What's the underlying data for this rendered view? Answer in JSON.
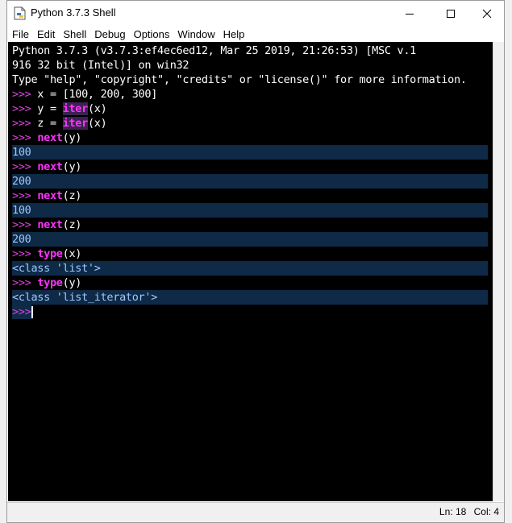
{
  "window": {
    "title": "Python 3.7.3 Shell",
    "controls": {
      "minimize": "—",
      "maximize": "☐",
      "close": "✕"
    }
  },
  "menu": [
    "File",
    "Edit",
    "Shell",
    "Debug",
    "Options",
    "Window",
    "Help"
  ],
  "console": {
    "banner1": "Python 3.7.3 (v3.7.3:ef4ec6ed12, Mar 25 2019, 21:26:53) [MSC v.1",
    "banner2": "916 32 bit (Intel)] on win32",
    "banner3": "Type \"help\", \"copyright\", \"credits\" or \"license()\" for more information.",
    "prompt": ">>>",
    "cmd1": " x = [100, 200, 300]",
    "cmd2_a": " y = ",
    "cmd2_fn": "iter",
    "cmd2_b": "(x)",
    "cmd3_a": " z = ",
    "cmd3_fn": "iter",
    "cmd3_b": "(x)",
    "cmd4_fn": "next",
    "cmd4_b": "(y)",
    "out4": "100",
    "cmd5_fn": "next",
    "cmd5_b": "(y)",
    "out5": "200",
    "cmd6_fn": "next",
    "cmd6_b": "(z)",
    "out6": "100",
    "cmd7_fn": "next",
    "cmd7_b": "(z)",
    "out7": "200",
    "cmd8_fn": "type",
    "cmd8_b": "(x)",
    "out8": "<class 'list'>",
    "cmd9_fn": "type",
    "cmd9_b": "(y)",
    "out9": "<class 'list_iterator'>"
  },
  "status": {
    "line": "Ln: 18",
    "col": "Col: 4"
  },
  "colors": {
    "console_bg": "#000000",
    "prompt": "#e040e0",
    "builtin": "#ff33ff",
    "output": "#9fc7ff"
  }
}
